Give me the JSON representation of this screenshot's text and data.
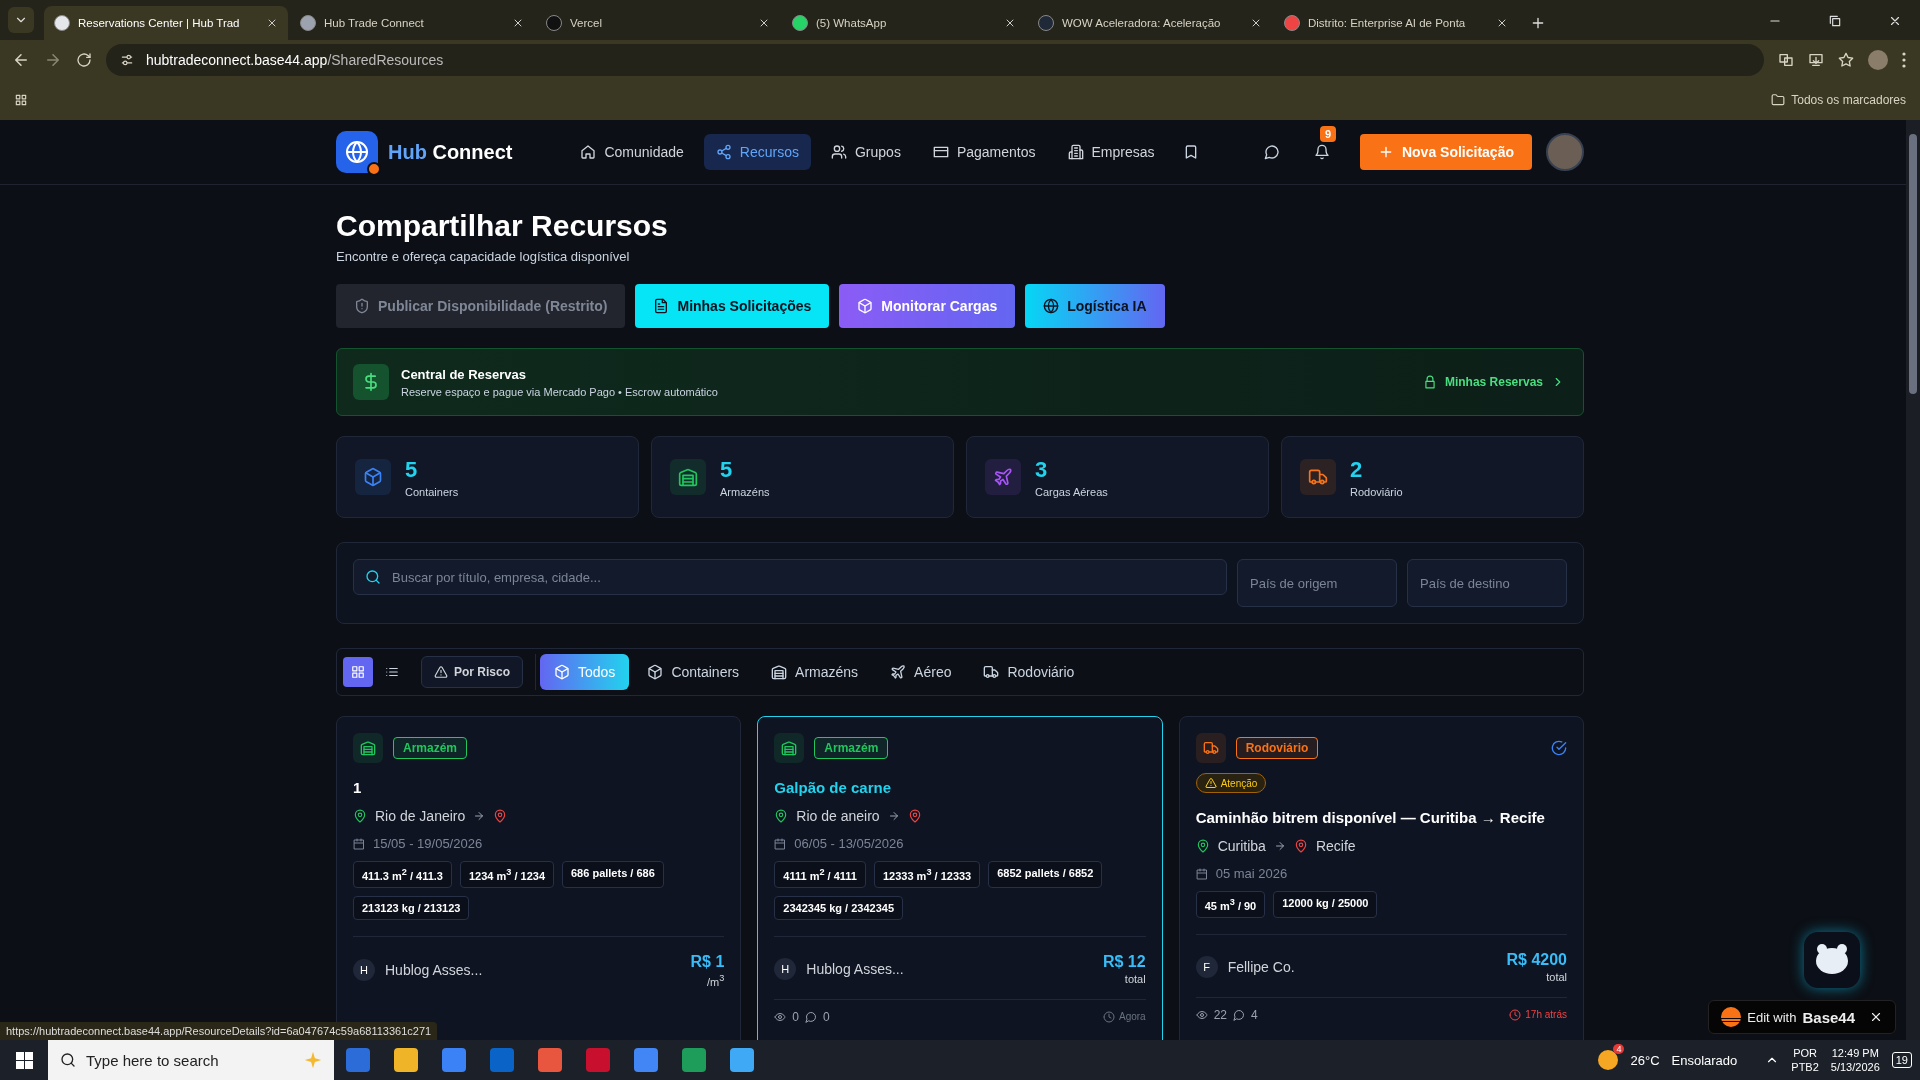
{
  "browser": {
    "tabs": [
      {
        "title": "Reservations Center | Hub Trad",
        "selected": true
      },
      {
        "title": "Hub Trade Connect",
        "selected": false
      },
      {
        "title": "Vercel",
        "selected": false
      },
      {
        "title": "(5) WhatsApp",
        "selected": false
      },
      {
        "title": "WOW Aceleradora: Aceleração",
        "selected": false
      },
      {
        "title": "Distrito: Enterprise AI de Ponta",
        "selected": false
      }
    ],
    "url_host": "hubtradeconnect.base44.app",
    "url_path": "/SharedResources",
    "bookmarks_folder": "Todos os marcadores"
  },
  "header": {
    "brand_first": "Hub",
    "brand_second": "Connect",
    "nav": [
      {
        "label": "Comunidade",
        "selected": false
      },
      {
        "label": "Recursos",
        "selected": true
      },
      {
        "label": "Grupos",
        "selected": false
      },
      {
        "label": "Pagamentos",
        "selected": false
      },
      {
        "label": "Empresas",
        "selected": false
      }
    ],
    "notification_count": "9",
    "new_request_button": "Nova Solicitação"
  },
  "page": {
    "title": "Compartilhar Recursos",
    "subtitle": "Encontre e ofereça capacidade logística disponível",
    "actions": [
      {
        "label": "Publicar Disponibilidade (Restrito)",
        "kind": "restricted",
        "disabled": true
      },
      {
        "label": "Minhas Solicitações",
        "kind": "requests",
        "disabled": false
      },
      {
        "label": "Monitorar Cargas",
        "kind": "monitor",
        "disabled": false
      },
      {
        "label": "Logística IA",
        "kind": "ai",
        "disabled": false
      }
    ],
    "reserve_banner": {
      "title": "Central de Reservas",
      "subtitle": "Reserve espaço e pague via Mercado Pago • Escrow automático",
      "link": "Minhas Reservas"
    },
    "stats": [
      {
        "kind": "container",
        "value": "5",
        "label": "Containers",
        "color": "#3b82f6"
      },
      {
        "kind": "warehouse",
        "value": "5",
        "label": "Armazéns",
        "color": "#22c55e"
      },
      {
        "kind": "air",
        "value": "3",
        "label": "Cargas Aéreas",
        "color": "#a855f7"
      },
      {
        "kind": "road",
        "value": "2",
        "label": "Rodoviário",
        "color": "#f97316"
      }
    ],
    "search": {
      "placeholder": "Buscar por título, empresa, cidade...",
      "origin_placeholder": "País de origem",
      "destination_placeholder": "País de destino"
    },
    "view_toggle": [
      {
        "kind": "grid",
        "selected": true
      },
      {
        "kind": "list",
        "selected": false
      }
    ],
    "risk_filter": "Por Risco",
    "filters": [
      {
        "label": "Todos",
        "selected": true
      },
      {
        "label": "Containers",
        "selected": false
      },
      {
        "label": "Armazéns",
        "selected": false
      },
      {
        "label": "Aéreo",
        "selected": false
      },
      {
        "label": "Rodoviário",
        "selected": false
      }
    ],
    "cards": [
      {
        "kind": "warehouse",
        "type_label": "Armazém",
        "color": "#22c55e",
        "highlighted": false,
        "verified": false,
        "title": "1",
        "origin": "Rio de Janeiro",
        "date": "15/05 - 19/05/2026",
        "specs": [
          "411.3 m$^{2}$ / 411.3",
          "1234 m$^{3}$ / 1234",
          "686 pallets / 686",
          "213123 kg / 213123"
        ],
        "company_initial": "H",
        "company": "Hublog Asses...",
        "price": "R$ 1",
        "price_unit": "/m$^{3}$"
      },
      {
        "kind": "warehouse",
        "type_label": "Armazém",
        "color": "#22c55e",
        "highlighted": true,
        "verified": false,
        "title": "Galpão de carne",
        "origin": "Rio de aneiro",
        "date": "06/05 - 13/05/2026",
        "specs": [
          "4111 m$^{2}$ / 4111",
          "12333 m$^{3}$ / 12333",
          "6852 pallets / 6852",
          "2342345 kg / 2342345"
        ],
        "company_initial": "H",
        "company": "Hublog Asses...",
        "price": "R$ 12",
        "price_unit": "total",
        "views": "0",
        "comments": "0",
        "time": "Agora",
        "time_alert": false
      },
      {
        "kind": "road",
        "type_label": "Rodoviário",
        "color": "#f97316",
        "highlighted": false,
        "verified": true,
        "warning": "Atenção",
        "title": "Caminhão bitrem disponível — Curitiba → Recife",
        "origin": "Curitiba",
        "destination": "Recife",
        "date": "05 mai 2026",
        "specs": [
          "45 m$^{3}$ / 90",
          "12000 kg / 25000"
        ],
        "company_initial": "F",
        "company": "Fellipe Co.",
        "price": "R$ 4200",
        "price_unit": "total",
        "views": "22",
        "comments": "4",
        "time": "17h atrás",
        "time_alert": true
      }
    ]
  },
  "status_url": "https://hubtradeconnect.base44.app/ResourceDetails?id=6a047674c59a68113361c271",
  "edit_badge": {
    "text": "Edit with",
    "brand": "Base44"
  },
  "taskbar": {
    "search_placeholder": "Type here to search",
    "weather_badge": "4",
    "temperature": "26°C",
    "weather": "Ensolarado",
    "language": "POR",
    "layout": "PTB2",
    "time": "12:49 PM",
    "date": "5/13/2026",
    "notifications": "19"
  }
}
